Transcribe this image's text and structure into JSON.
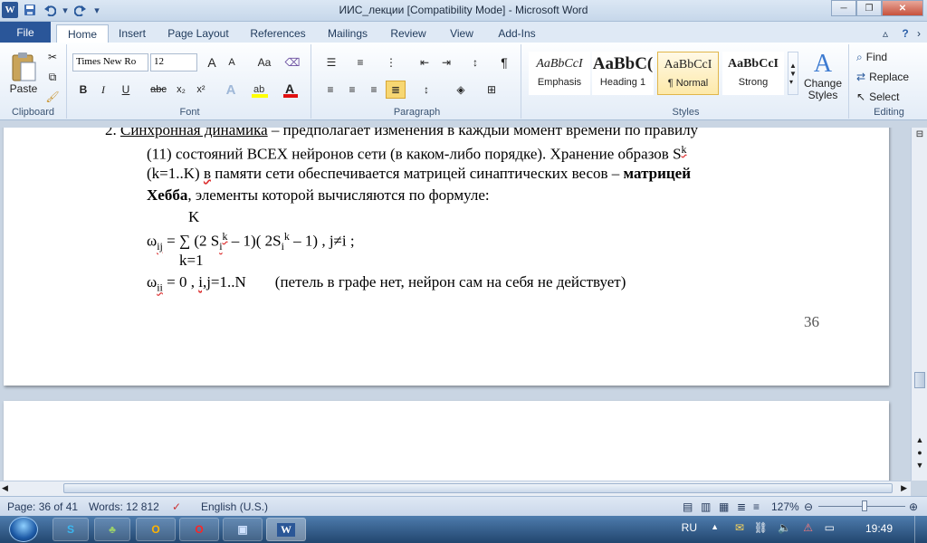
{
  "titlebar": {
    "title": "ИИС_лекции [Compatibility Mode]  -  Microsoft Word",
    "app_icon": "W",
    "qat_icons": [
      "save-icon",
      "undo-icon",
      "redo-icon",
      "customize-icon"
    ]
  },
  "tabs": [
    "File",
    "Home",
    "Insert",
    "Page Layout",
    "References",
    "Mailings",
    "Review",
    "View",
    "Add-Ins"
  ],
  "active_tab": "Home",
  "ribbon": {
    "clipboard": {
      "label": "Clipboard",
      "paste": "Paste"
    },
    "font": {
      "label": "Font",
      "font_name": "Times New Ro",
      "font_size": "12",
      "bold": "B",
      "italic": "I",
      "underline": "U",
      "strike": "abc",
      "sub": "x₂",
      "sup": "x²",
      "grow": "A",
      "shrink": "A",
      "case": "Aa"
    },
    "paragraph": {
      "label": "Paragraph",
      "pilcrow": "¶"
    },
    "styles": {
      "label": "Styles",
      "items": [
        {
          "sample": "AaBbCcI",
          "name": "Emphasis"
        },
        {
          "sample": "AaBbC(",
          "name": "Heading 1"
        },
        {
          "sample": "AaBbCcI",
          "name": "¶ Normal"
        },
        {
          "sample": "AaBbCcI",
          "name": "Strong"
        }
      ],
      "change_styles": "Change Styles"
    },
    "editing": {
      "label": "Editing",
      "find": "Find",
      "replace": "Replace",
      "select": "Select"
    }
  },
  "document": {
    "item_number": "2.",
    "item_title": "Синхронная динамика",
    "line1_rest": " – предполагает изменения в каждый момент времени по правилу",
    "line2": "(11) состояний ВСЕХ нейронов сети (в каком-либо порядке). Хранение образов S",
    "line2_sup": "k",
    "line3_a": "(k=1..K) ",
    "line3_b": "в",
    "line3_c": " памяти сети обеспечивается матрицей синаптических весов – ",
    "line3_bold": "матрицей",
    "line4_bold": "Хебба",
    "line4_rest": ", элементы которой вычисляются по формуле:",
    "sum_upper": "K",
    "formula_omega": "ω",
    "formula_sub": "ij",
    "formula_body_a": " = ∑ (2 S",
    "formula_sub_i": "i",
    "formula_sup_k": "k",
    "formula_body_b": " – 1)( 2S",
    "formula_sub_i2": "i",
    "formula_sup_k2": "k",
    "formula_body_c": " – 1) , j≠i ;",
    "sum_lower": "k=1",
    "line_omega2_sub": "ii",
    "line_omega2_a": " = 0 , ",
    "line_omega2_b": "i,j",
    "line_omega2_c": "=1..N",
    "line_omega2_note": "(петель в графе нет, нейрон сам на себя не действует)",
    "page_number": "36"
  },
  "status": {
    "page": "Page: 36 of 41",
    "words": "Words: 12 812",
    "language": "English (U.S.)",
    "zoom": "127%",
    "zoom_value": 127
  },
  "taskbar": {
    "lang": "RU",
    "time": "19:49"
  }
}
